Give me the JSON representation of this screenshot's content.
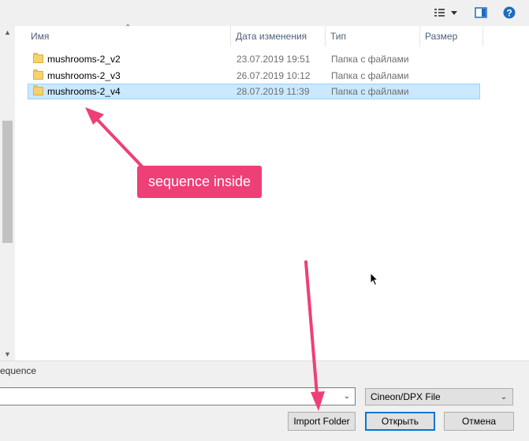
{
  "columns": {
    "name": "Имя",
    "date": "Дата изменения",
    "type": "Тип",
    "size": "Размер"
  },
  "files": [
    {
      "name": "mushrooms-2_v2",
      "date": "23.07.2019 19:51",
      "type": "Папка с файлами",
      "selected": false
    },
    {
      "name": "mushrooms-2_v3",
      "date": "26.07.2019 10:12",
      "type": "Папка с файлами",
      "selected": false
    },
    {
      "name": "mushrooms-2_v4",
      "date": "28.07.2019 11:39",
      "type": "Папка с файлами",
      "selected": true
    }
  ],
  "annotation": {
    "callout": "sequence inside"
  },
  "bottom": {
    "partial_label": "equence",
    "filename_value": "",
    "filter_value": "Cineon/DPX File",
    "import_label": "Import Folder",
    "open_label": "Открыть",
    "cancel_label": "Отмена"
  },
  "icons": {
    "view": "view-details-icon",
    "pane": "preview-pane-icon",
    "help": "help-icon",
    "folder": "folder-icon"
  },
  "colors": {
    "accent": "#0078d7",
    "annotation": "#ee3f76",
    "selection": "#cce8ff",
    "help": "#1c6cc1"
  }
}
